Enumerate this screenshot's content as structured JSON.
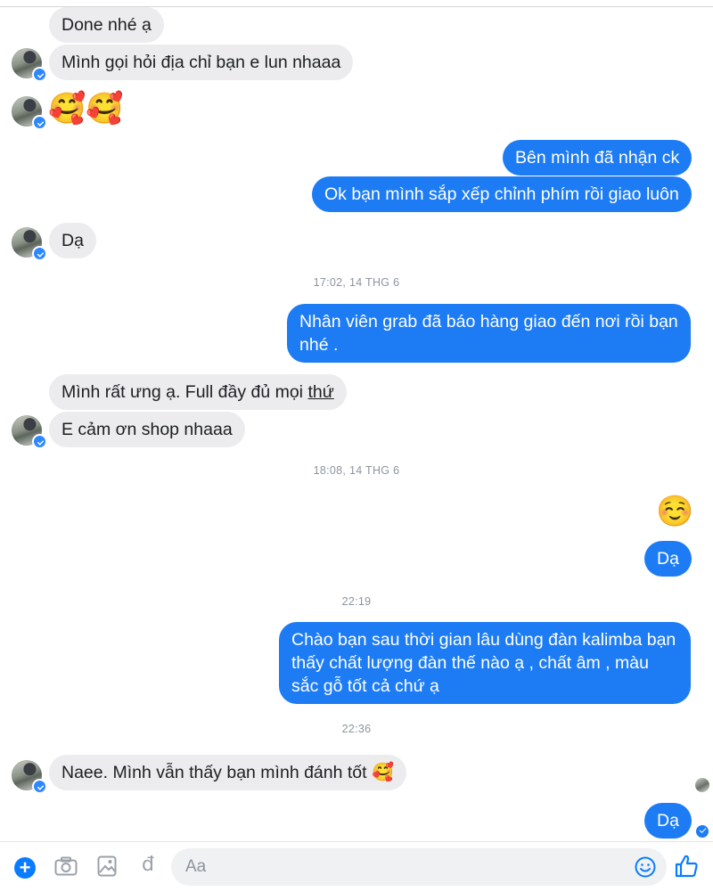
{
  "messages": {
    "m1": "Done nhé ạ",
    "m2": "Mình gọi hỏi địa chỉ bạn e lun nhaaa",
    "m3": "🥰🥰",
    "m4": "Bên mình đã nhận ck",
    "m5": "Ok bạn mình sắp xếp chỉnh phím rồi giao luôn",
    "m6": "Dạ",
    "m7": "Nhân viên grab đã báo hàng giao đến nơi rồi bạn nhé .",
    "m8_main": "Mình rất ưng ạ. Full đầy đủ mọi ",
    "m8_underlined": "thứ",
    "m9": "E cảm ơn shop nhaaa",
    "m10": "☺️",
    "m11": "Dạ",
    "m12": "Chào bạn sau thời gian lâu dùng đàn kalimba bạn thấy chất lượng đàn thế nào ạ , chất âm , màu sắc gỗ tốt cả chứ ạ",
    "m13_text": "Naee. Mình vẫn thấy bạn mình đánh tốt ",
    "m13_emoji": "🥰",
    "m14": "Dạ"
  },
  "timestamps": {
    "t1": "17:02, 14 THG 6",
    "t2": "18:08, 14 THG 6",
    "t3": "22:19",
    "t4": "22:36"
  },
  "composer": {
    "placeholder": "Aa",
    "currency_symbol": "đ"
  },
  "colors": {
    "outgoing_bubble": "#1d7cf4",
    "incoming_bubble": "#ececee",
    "accent": "#0a7cff"
  }
}
